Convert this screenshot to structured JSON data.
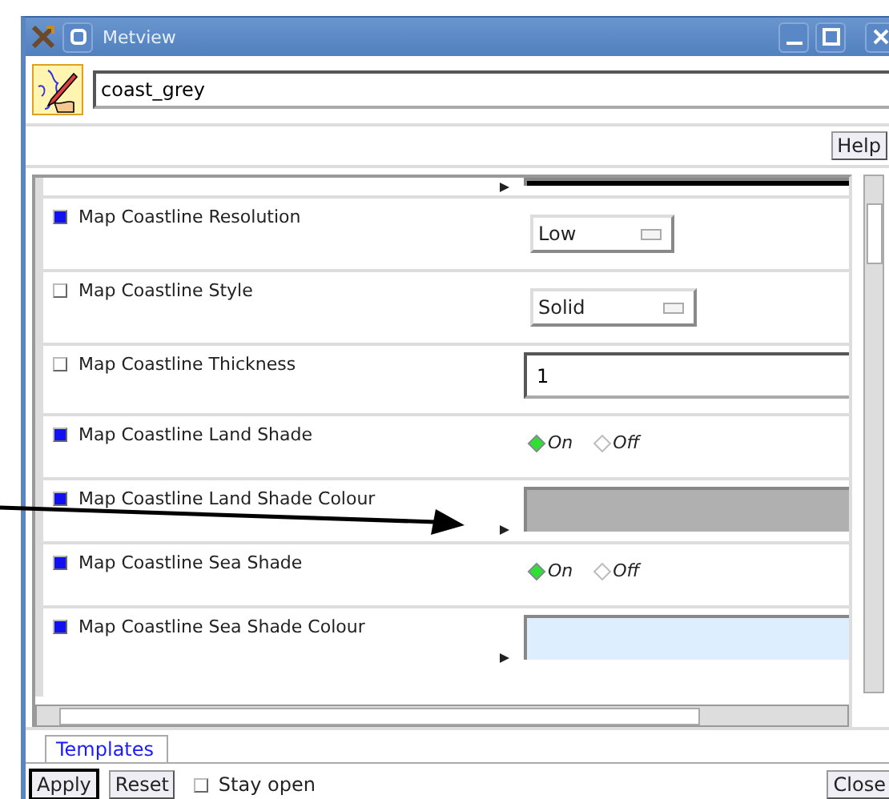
{
  "window": {
    "title": "Metview"
  },
  "icon_name": "coast_grey",
  "help_button": "Help",
  "params": [
    {
      "kind": "colour",
      "color": "#000000"
    },
    {
      "kind": "menu",
      "label": "Map Coastline Resolution",
      "set": true,
      "value": "Low"
    },
    {
      "kind": "menu",
      "label": "Map Coastline Style",
      "set": false,
      "value": "Solid"
    },
    {
      "kind": "text",
      "label": "Map Coastline Thickness",
      "set": false,
      "value": "1"
    },
    {
      "kind": "radio",
      "label": "Map Coastline Land Shade",
      "set": true,
      "options": [
        {
          "label": "On",
          "selected": true
        },
        {
          "label": "Off",
          "selected": false
        }
      ]
    },
    {
      "kind": "colour",
      "label": "Map Coastline Land Shade Colour",
      "set": true,
      "color": "#b0b0b0"
    },
    {
      "kind": "radio",
      "label": "Map Coastline Sea Shade",
      "set": true,
      "options": [
        {
          "label": "On",
          "selected": true
        },
        {
          "label": "Off",
          "selected": false
        }
      ]
    },
    {
      "kind": "colour",
      "label": "Map Coastline Sea Shade Colour",
      "set": true,
      "color": "#dceeff"
    }
  ],
  "tabs": [
    {
      "label": "Templates",
      "selected": true
    }
  ],
  "apply_button": "Apply",
  "reset_button": "Reset",
  "stay_open": {
    "label": "Stay open",
    "checked": false
  },
  "close_button": "Close"
}
